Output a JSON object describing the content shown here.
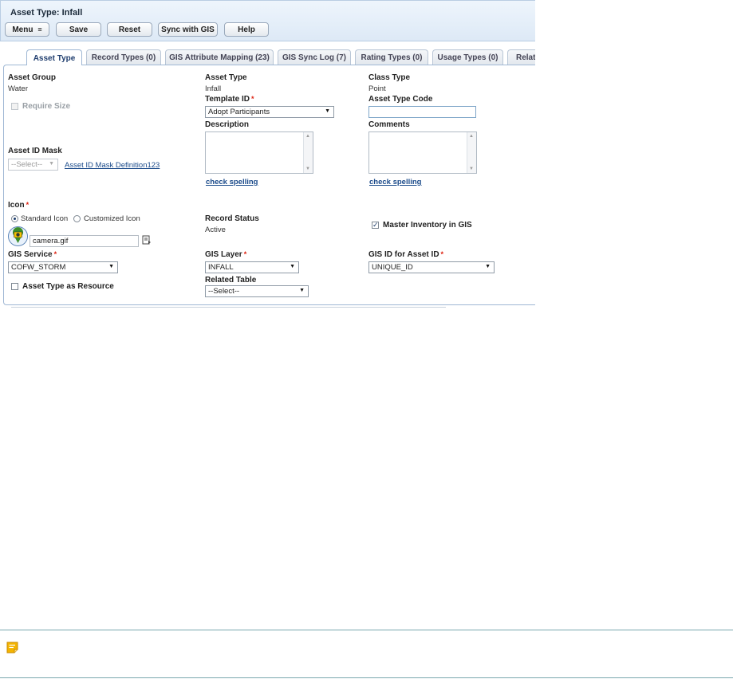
{
  "header": {
    "title": "Asset Type: Infall",
    "buttons": {
      "menu": "Menu",
      "save": "Save",
      "reset": "Reset",
      "sync": "Sync with GIS",
      "help": "Help"
    }
  },
  "tabs": [
    {
      "label": "Asset Type",
      "active": true
    },
    {
      "label": "Record Types (0)"
    },
    {
      "label": "GIS Attribute Mapping (23)"
    },
    {
      "label": "GIS Sync Log (7)"
    },
    {
      "label": "Rating Types (0)"
    },
    {
      "label": "Usage Types (0)"
    },
    {
      "label": "Relat"
    }
  ],
  "form": {
    "asset_group": {
      "label": "Asset Group",
      "value": "Water"
    },
    "require_size": {
      "label": "Require Size",
      "checked": false,
      "disabled": true
    },
    "asset_id_mask": {
      "label": "Asset ID Mask",
      "value": "--Select--",
      "link": "Asset ID Mask Definition123"
    },
    "asset_type": {
      "label": "Asset Type",
      "value": "Infall"
    },
    "template_id": {
      "label": "Template ID",
      "required_mark": "*",
      "value": "Adopt Participants"
    },
    "description": {
      "label": "Description",
      "check_spelling": "check spelling"
    },
    "class_type": {
      "label": "Class Type",
      "value": "Point"
    },
    "asset_type_code": {
      "label": "Asset Type Code",
      "value": ""
    },
    "comments": {
      "label": "Comments",
      "check_spelling": "check spelling"
    },
    "icon": {
      "label": "Icon",
      "required_mark": "*",
      "standard_label": "Standard Icon",
      "customized_label": "Customized Icon",
      "selected": "standard",
      "filename": "camera.gif"
    },
    "record_status": {
      "label": "Record Status",
      "value": "Active"
    },
    "master_inventory": {
      "label": "Master Inventory in GIS",
      "checked": true
    },
    "gis_service": {
      "label": "GIS Service",
      "required_mark": "*",
      "value": "COFW_STORM"
    },
    "asset_type_as_resource": {
      "label": "Asset Type as Resource",
      "checked": false
    },
    "gis_layer": {
      "label": "GIS Layer",
      "required_mark": "*",
      "value": "INFALL"
    },
    "related_table": {
      "label": "Related Table",
      "value": "--Select--"
    },
    "gis_id_for_asset_id": {
      "label": "GIS ID for Asset ID",
      "required_mark": "*",
      "value": "UNIQUE_ID"
    }
  },
  "icons": {
    "menu_dropdown": "menu-lines-icon",
    "select_caret": "caret-down-icon",
    "icon_preview": "camera-icon",
    "browse_file": "file-browse-icon",
    "note": "note-icon"
  },
  "colors": {
    "accent": "#1a4a8a",
    "required": "#dd1111",
    "header_bg": "#dde9f6",
    "note_icon": "#f4b400"
  }
}
